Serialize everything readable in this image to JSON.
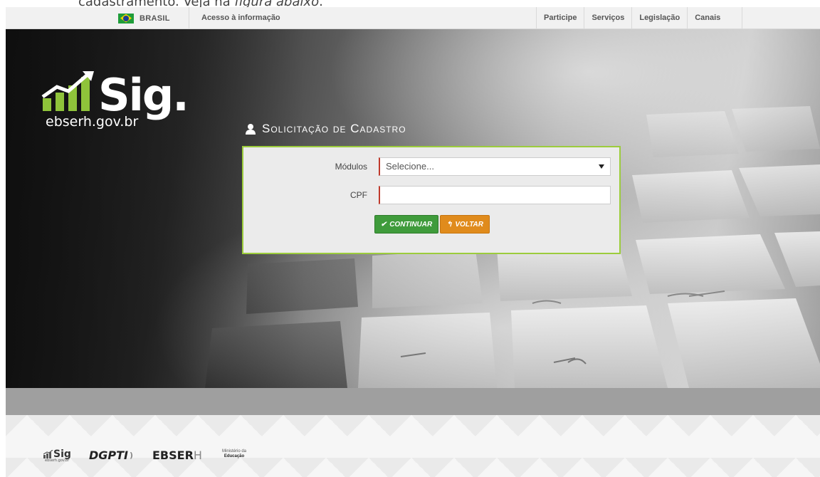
{
  "doc_fragment": {
    "prefix": "cadastramento. Veja na ",
    "italic": "figura abaixo",
    "suffix": "."
  },
  "govbar": {
    "country": "BRASIL",
    "access_info": "Acesso à informação",
    "links": [
      "Participe",
      "Serviços",
      "Legislação",
      "Canais"
    ]
  },
  "logo": {
    "name": "Sig.",
    "domain": "ebserh.gov.br"
  },
  "form": {
    "title": "Solicitação de Cadastro",
    "modules_label": "Módulos",
    "modules_value": "Selecione...",
    "cpf_label": "CPF",
    "cpf_value": "",
    "continue_label": "CONTINUAR",
    "back_label": "VOLTAR",
    "accent_color": "#9ccc3c",
    "required_color": "#c0392b"
  },
  "footer": {
    "logos": {
      "sig": "Sig",
      "sig_domain": "ebserh.gov.br",
      "dgpti": "DGPTI",
      "ebserh_bold": "EBSER",
      "ebserh_light": "H",
      "mec_line1": "Ministério da",
      "mec_line2": "Educação"
    }
  }
}
